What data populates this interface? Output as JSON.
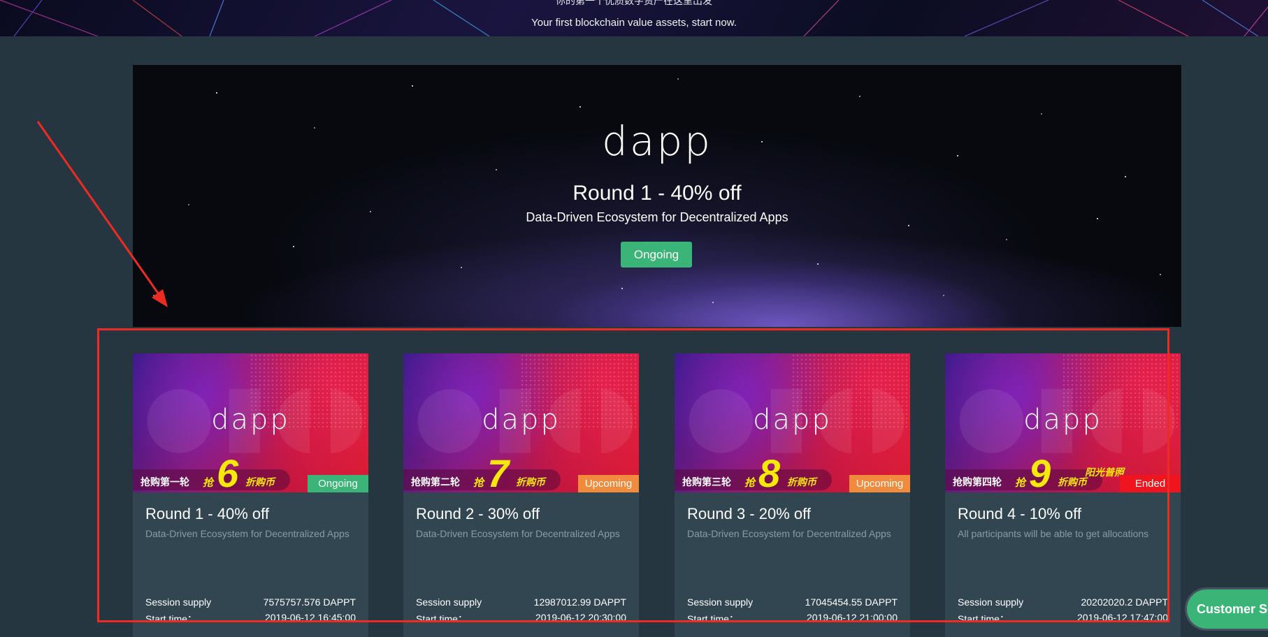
{
  "hero": {
    "tagline_cn": "你的第一个优质数字资产在这里出发",
    "tagline_en": "Your first blockchain value assets, start now."
  },
  "banner": {
    "logo": "dapp",
    "title": "Round 1 - 40% off",
    "subtitle": "Data-Driven Ecosystem for Decentralized Apps",
    "button": "Ongoing"
  },
  "labels": {
    "supply": "Session supply",
    "start": "Start time："
  },
  "cards": [
    {
      "logo": "dapp",
      "promo_prefix": "抢购第一轮",
      "promo_grab": "抢",
      "promo_number": "6",
      "promo_suffix": "折购币",
      "promo_extra": "",
      "status": "Ongoing",
      "status_color": "#3bb577",
      "title": "Round 1 - 40% off",
      "desc": "Data-Driven Ecosystem for Decentralized Apps",
      "supply": "7575757.576 DAPPT",
      "start": "2019-06-12 16:45:00"
    },
    {
      "logo": "dapp",
      "promo_prefix": "抢购第二轮",
      "promo_grab": "抢",
      "promo_number": "7",
      "promo_suffix": "折购币",
      "promo_extra": "",
      "status": "Upcoming",
      "status_color": "#f08a3c",
      "title": "Round 2 - 30% off",
      "desc": "Data-Driven Ecosystem for Decentralized Apps",
      "supply": "12987012.99 DAPPT",
      "start": "2019-06-12 20:30:00"
    },
    {
      "logo": "dapp",
      "promo_prefix": "抢购第三轮",
      "promo_grab": "抢",
      "promo_number": "8",
      "promo_suffix": "折购币",
      "promo_extra": "",
      "status": "Upcoming",
      "status_color": "#f08a3c",
      "title": "Round 3 - 20% off",
      "desc": "Data-Driven Ecosystem for Decentralized Apps",
      "supply": "17045454.55 DAPPT",
      "start": "2019-06-12 21:00:00"
    },
    {
      "logo": "dapp",
      "promo_prefix": "抢购第四轮",
      "promo_grab": "抢",
      "promo_number": "9",
      "promo_suffix": "折购币",
      "promo_extra": "阳光普照",
      "status": "Ended",
      "status_color": "#f0141e",
      "title": "Round 4 - 10% off",
      "desc": "All participants will be able to get allocations",
      "supply": "20202020.2 DAPPT",
      "start": "2019-06-12 17:47:00"
    }
  ],
  "customer_service": "Customer Service",
  "colors": {
    "page_bg": "#253641",
    "card_bg": "#324652",
    "accent_green": "#3bb577",
    "annotation_red": "#ee2b22"
  }
}
